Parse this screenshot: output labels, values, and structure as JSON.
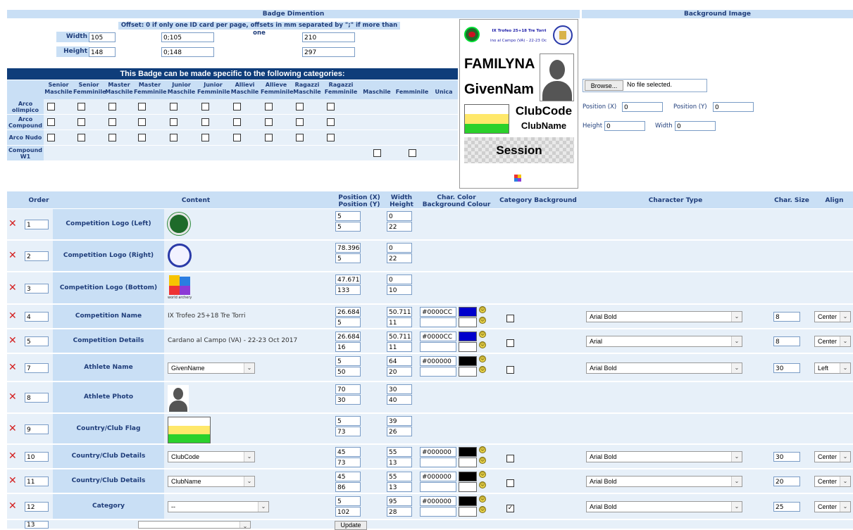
{
  "badge_section": {
    "title": "Badge Dimention",
    "offset_note": "Offset: 0 if only one ID card per page, offsets in mm separated by \";\" if more than one",
    "width_label": "Width",
    "height_label": "Height",
    "width_value": "105",
    "height_value": "148",
    "width_offset": "0;105",
    "height_offset": "0;148",
    "width_total": "210",
    "height_total": "297"
  },
  "background_section": {
    "title": "Background Image",
    "browse_label": "Browse...",
    "file_status": "No file selected.",
    "posx_label": "Position (X)",
    "posx_value": "0",
    "posy_label": "Position (Y)",
    "posy_value": "0",
    "height_label": "Height",
    "height_value": "0",
    "width_label": "Width",
    "width_value": "0"
  },
  "categories": {
    "banner": "This Badge can be made specific to the following categories:",
    "columns": [
      "Senior Maschile",
      "Senior Femminile",
      "Master Maschile",
      "Master Femminile",
      "Junior Maschile",
      "Junior Femminile",
      "Allievi Maschile",
      "Allieve Femminile",
      "Ragazzi Maschile",
      "Ragazzi Femminile",
      "Maschile",
      "Femminile",
      "Unica"
    ],
    "columns_split": [
      [
        "Senior",
        "Maschile"
      ],
      [
        "Senior",
        "Femminile"
      ],
      [
        "Master",
        "Maschile"
      ],
      [
        "Master",
        "Femminile"
      ],
      [
        "Junior",
        "Maschile"
      ],
      [
        "Junior",
        "Femminile"
      ],
      [
        "Allievi",
        "Maschile"
      ],
      [
        "Allieve",
        "Femminile"
      ],
      [
        "Ragazzi",
        "Maschile"
      ],
      [
        "Ragazzi",
        "Femminile"
      ],
      [
        "",
        "Maschile"
      ],
      [
        "",
        "Femminile"
      ],
      [
        "",
        "Unica"
      ]
    ],
    "rows": [
      {
        "label": "Arco olimpico"
      },
      {
        "label": "Arco Compound"
      },
      {
        "label": "Arco Nudo"
      },
      {
        "label": "Compound W1"
      }
    ]
  },
  "preview": {
    "comp_name": "IX Trofeo 25+18 Tre Torri",
    "comp_details": "ino al Campo (VA) - 22-23 Oc",
    "family_name": "FAMILYNA",
    "given_name": "GivenNam",
    "club_code": "ClubCode",
    "club_name": "ClubName",
    "session": "Session"
  },
  "table": {
    "headers": {
      "order": "Order",
      "content": "Content",
      "position_x": "Position (X)",
      "position_y": "Position (Y)",
      "width": "Width",
      "height": "Height",
      "char_color": "Char. Color",
      "bg_color": "Background Colour",
      "category_bg": "Category Background",
      "char_type": "Character Type",
      "char_size": "Char. Size",
      "align": "Align"
    },
    "rows": [
      {
        "order": "1",
        "label": "Competition Logo (Left)",
        "content": "",
        "posx": "5",
        "posy": "5",
        "w": "0",
        "h": "22"
      },
      {
        "order": "2",
        "label": "Competition Logo (Right)",
        "content": "",
        "posx": "78.3963",
        "posy": "5",
        "w": "0",
        "h": "22"
      },
      {
        "order": "3",
        "label": "Competition Logo (Bottom)",
        "content": "world archery",
        "posx": "47.6713",
        "posy": "133",
        "w": "0",
        "h": "10"
      },
      {
        "order": "4",
        "label": "Competition Name",
        "content": "IX Trofeo 25+18 Tre Torri",
        "posx": "26.6847",
        "posy": "5",
        "w": "50.7116",
        "h": "11",
        "color": "#0000CC",
        "swatch": "#0000cc",
        "font": "Arial Bold",
        "size": "8",
        "align": "Center"
      },
      {
        "order": "5",
        "label": "Competition Details",
        "content": "Cardano al Campo (VA) - 22-23 Oct 2017",
        "posx": "26.6847",
        "posy": "16",
        "w": "50.7116",
        "h": "11",
        "color": "#0000CC",
        "swatch": "#0000cc",
        "font": "Arial",
        "size": "8",
        "align": "Center"
      },
      {
        "order": "7",
        "label": "Athlete Name",
        "content": "GivenName",
        "posx": "5",
        "posy": "50",
        "w": "64",
        "h": "20",
        "color": "#000000",
        "swatch": "#000000",
        "font": "Arial Bold",
        "size": "30",
        "align": "Left"
      },
      {
        "order": "8",
        "label": "Athlete Photo",
        "content": "",
        "posx": "70",
        "posy": "30",
        "w": "30",
        "h": "40"
      },
      {
        "order": "9",
        "label": "Country/Club Flag",
        "content": "",
        "posx": "5",
        "posy": "73",
        "w": "39",
        "h": "26"
      },
      {
        "order": "10",
        "label": "Country/Club Details",
        "content": "ClubCode",
        "posx": "45",
        "posy": "73",
        "w": "55",
        "h": "13",
        "color": "#000000",
        "swatch": "#000000",
        "font": "Arial Bold",
        "size": "30",
        "align": "Center"
      },
      {
        "order": "11",
        "label": "Country/Club Details",
        "content": "ClubName",
        "posx": "45",
        "posy": "86",
        "w": "55",
        "h": "13",
        "color": "#000000",
        "swatch": "#000000",
        "font": "Arial Bold",
        "size": "20",
        "align": "Center"
      },
      {
        "order": "12",
        "label": "Category",
        "content": "--",
        "posx": "5",
        "posy": "102",
        "w": "95",
        "h": "28",
        "color": "#000000",
        "swatch": "#000000",
        "font": "Arial Bold",
        "size": "25",
        "align": "Center",
        "checked": true
      }
    ],
    "new_row_order": "13",
    "update_label": "Update"
  }
}
